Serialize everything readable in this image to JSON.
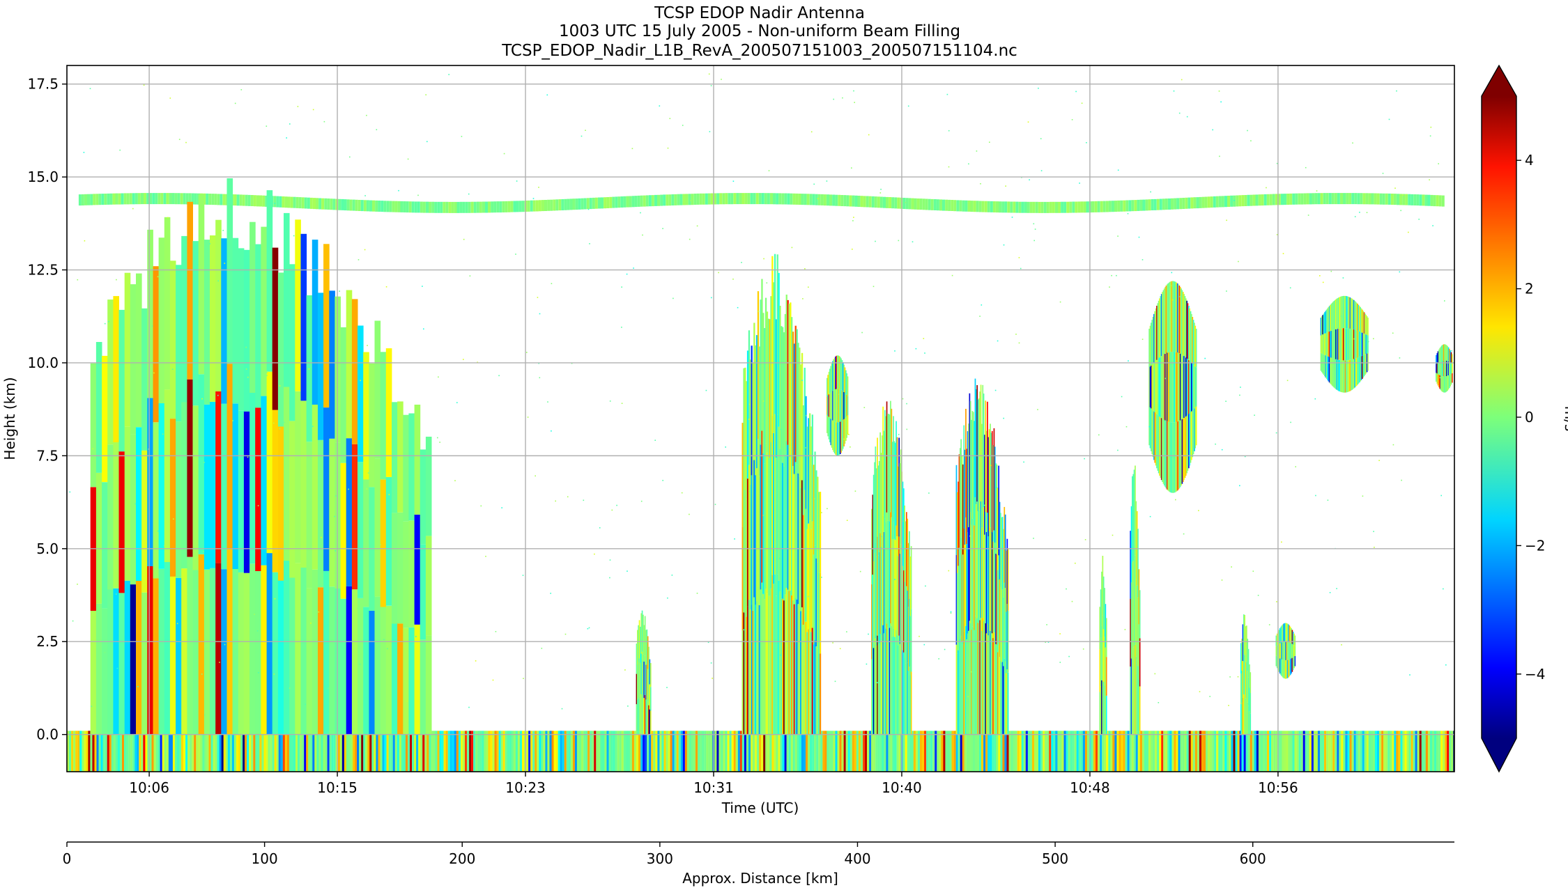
{
  "chart_data": {
    "type": "heatmap",
    "title_lines": [
      "TCSP EDOP Nadir Antenna",
      "1003 UTC 15 July 2005 - Non-uniform Beam Filling",
      "TCSP_EDOP_Nadir_L1B_RevA_200507151003_200507151104.nc"
    ],
    "xlabel": "Time (UTC)",
    "ylabel": "Height (km)",
    "x_ticks": [
      "10:06",
      "10:15",
      "10:23",
      "10:31",
      "10:40",
      "10:48",
      "10:56"
    ],
    "x_range_minutes": [
      2.5,
      61.5
    ],
    "x_tick_minutes": [
      6,
      14,
      22,
      30,
      38,
      46,
      54
    ],
    "y_ticks": [
      "0.0",
      "2.5",
      "5.0",
      "7.5",
      "10.0",
      "12.5",
      "15.0",
      "17.5"
    ],
    "y_tick_values": [
      0,
      2.5,
      5,
      7.5,
      10,
      12.5,
      15,
      17.5
    ],
    "ylim": [
      -1,
      18
    ],
    "grid": true,
    "colorbar": {
      "label": "m/s",
      "ticks": [
        "4",
        "2",
        "0",
        "−2",
        "−4"
      ],
      "tick_values": [
        4,
        2,
        0,
        -2,
        -4
      ],
      "range": [
        -5,
        5
      ],
      "colormap": "jet",
      "extend": "both"
    },
    "secondary_axis": {
      "label": "Approx. Distance [km]",
      "ticks": [
        "0",
        "100",
        "200",
        "300",
        "400",
        "500",
        "600"
      ],
      "tick_values": [
        0,
        100,
        200,
        300,
        400,
        500,
        600
      ],
      "range": [
        0,
        702
      ]
    },
    "features": [
      {
        "kind": "surface_band",
        "height_km": [
          -1,
          0.1
        ]
      },
      {
        "kind": "tropopause_layer",
        "height_km": 14.3,
        "minutes": [
          3,
          61
        ]
      },
      {
        "kind": "convection",
        "minutes": [
          3.5,
          18
        ],
        "top_km": 15
      },
      {
        "kind": "convection",
        "minutes": [
          26.7,
          27.3
        ],
        "top_km": 3.5
      },
      {
        "kind": "convection",
        "minutes": [
          31.2,
          34.5
        ],
        "top_km": 13
      },
      {
        "kind": "anvil",
        "minutes": [
          34.8,
          35.7
        ],
        "height_km": [
          7.5,
          10.2
        ]
      },
      {
        "kind": "convection",
        "minutes": [
          36.7,
          38.4
        ],
        "top_km": 9.2
      },
      {
        "kind": "convection",
        "minutes": [
          40.3,
          42.5
        ],
        "top_km": 9.7
      },
      {
        "kind": "convection",
        "minutes": [
          46.4,
          46.7
        ],
        "top_km": 5
      },
      {
        "kind": "convection",
        "minutes": [
          47.7,
          48.1
        ],
        "top_km": 7.5
      },
      {
        "kind": "anvil",
        "minutes": [
          48.5,
          50.5
        ],
        "height_km": [
          6.5,
          12.2
        ]
      },
      {
        "kind": "convection",
        "minutes": [
          52.4,
          52.8
        ],
        "top_km": 3.3
      },
      {
        "kind": "cell",
        "minutes": [
          53.9,
          54.7
        ],
        "height_km": [
          1.5,
          3
        ]
      },
      {
        "kind": "anvil",
        "minutes": [
          55.8,
          57.8
        ],
        "height_km": [
          9.2,
          11.8
        ]
      },
      {
        "kind": "anvil",
        "minutes": [
          60.7,
          61.4
        ],
        "height_km": [
          9.2,
          10.5
        ]
      }
    ]
  }
}
